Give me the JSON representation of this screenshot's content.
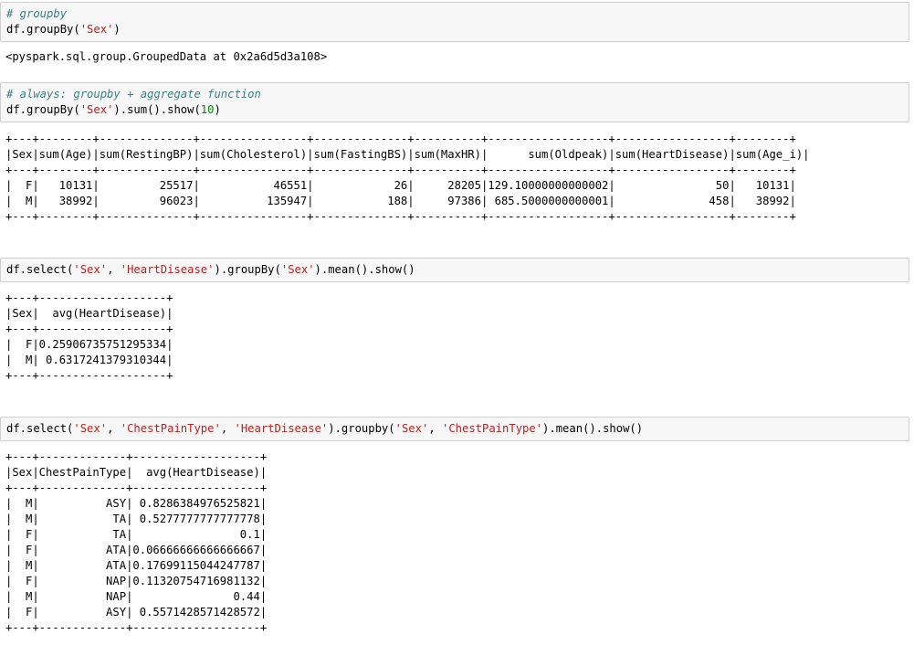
{
  "cells": [
    {
      "lines": [
        [
          {
            "t": "# groupby",
            "c": "cm"
          }
        ],
        [
          {
            "t": "df.groupBy(",
            "c": ""
          },
          {
            "t": "'Sex'",
            "c": "st"
          },
          {
            "t": ")",
            "c": ""
          }
        ]
      ],
      "output": [
        "<pyspark.sql.group.GroupedData at 0x2a6d5d3a108>"
      ]
    },
    {
      "lines": [
        [
          {
            "t": "# always: groupby + aggregate function",
            "c": "cm"
          }
        ],
        [
          {
            "t": "df.groupBy(",
            "c": ""
          },
          {
            "t": "'Sex'",
            "c": "st"
          },
          {
            "t": ").sum().show(",
            "c": ""
          },
          {
            "t": "10",
            "c": "nu"
          },
          {
            "t": ")",
            "c": ""
          }
        ]
      ],
      "output": [
        "+---+--------+--------------+----------------+--------------+----------+------------------+-----------------+--------+",
        "|Sex|sum(Age)|sum(RestingBP)|sum(Cholesterol)|sum(FastingBS)|sum(MaxHR)|      sum(Oldpeak)|sum(HeartDisease)|sum(Age_i)|",
        "+---+--------+--------------+----------------+--------------+----------+------------------+-----------------+--------+",
        "|  F|   10131|         25517|           46551|            26|     28205|129.10000000000002|               50|   10131|",
        "|  M|   38992|         96023|          135947|           188|     97386| 685.5000000000001|              458|   38992|",
        "+---+--------+--------------+----------------+--------------+----------+------------------+-----------------+--------+"
      ]
    },
    {
      "lines": [
        [
          {
            "t": "df.select(",
            "c": ""
          },
          {
            "t": "'Sex'",
            "c": "st"
          },
          {
            "t": ", ",
            "c": ""
          },
          {
            "t": "'HeartDisease'",
            "c": "st"
          },
          {
            "t": ").groupBy(",
            "c": ""
          },
          {
            "t": "'Sex'",
            "c": "st"
          },
          {
            "t": ").mean().show()",
            "c": ""
          }
        ]
      ],
      "output": [
        "+---+-------------------+",
        "|Sex|  avg(HeartDisease)|",
        "+---+-------------------+",
        "|  F|0.25906735751295334|",
        "|  M| 0.6317241379310344|",
        "+---+-------------------+"
      ]
    },
    {
      "lines": [
        [
          {
            "t": "df.select(",
            "c": ""
          },
          {
            "t": "'Sex'",
            "c": "st"
          },
          {
            "t": ", ",
            "c": ""
          },
          {
            "t": "'ChestPainType'",
            "c": "st"
          },
          {
            "t": ", ",
            "c": ""
          },
          {
            "t": "'HeartDisease'",
            "c": "st"
          },
          {
            "t": ").groupby(",
            "c": ""
          },
          {
            "t": "'Sex'",
            "c": "st"
          },
          {
            "t": ", ",
            "c": ""
          },
          {
            "t": "'ChestPainType'",
            "c": "st"
          },
          {
            "t": ").mean().show()",
            "c": ""
          }
        ]
      ],
      "output": [
        "+---+-------------+-------------------+",
        "|Sex|ChestPainType|  avg(HeartDisease)|",
        "+---+-------------+-------------------+",
        "|  M|          ASY| 0.8286384976525821|",
        "|  M|           TA| 0.5277777777777778|",
        "|  F|           TA|                0.1|",
        "|  F|          ATA|0.06666666666666667|",
        "|  M|          ATA|0.17699115044247787|",
        "|  F|          NAP|0.11320754716981132|",
        "|  M|          NAP|               0.44|",
        "|  F|          ASY| 0.5571428571428572|",
        "+---+-------------+-------------------+"
      ]
    }
  ]
}
